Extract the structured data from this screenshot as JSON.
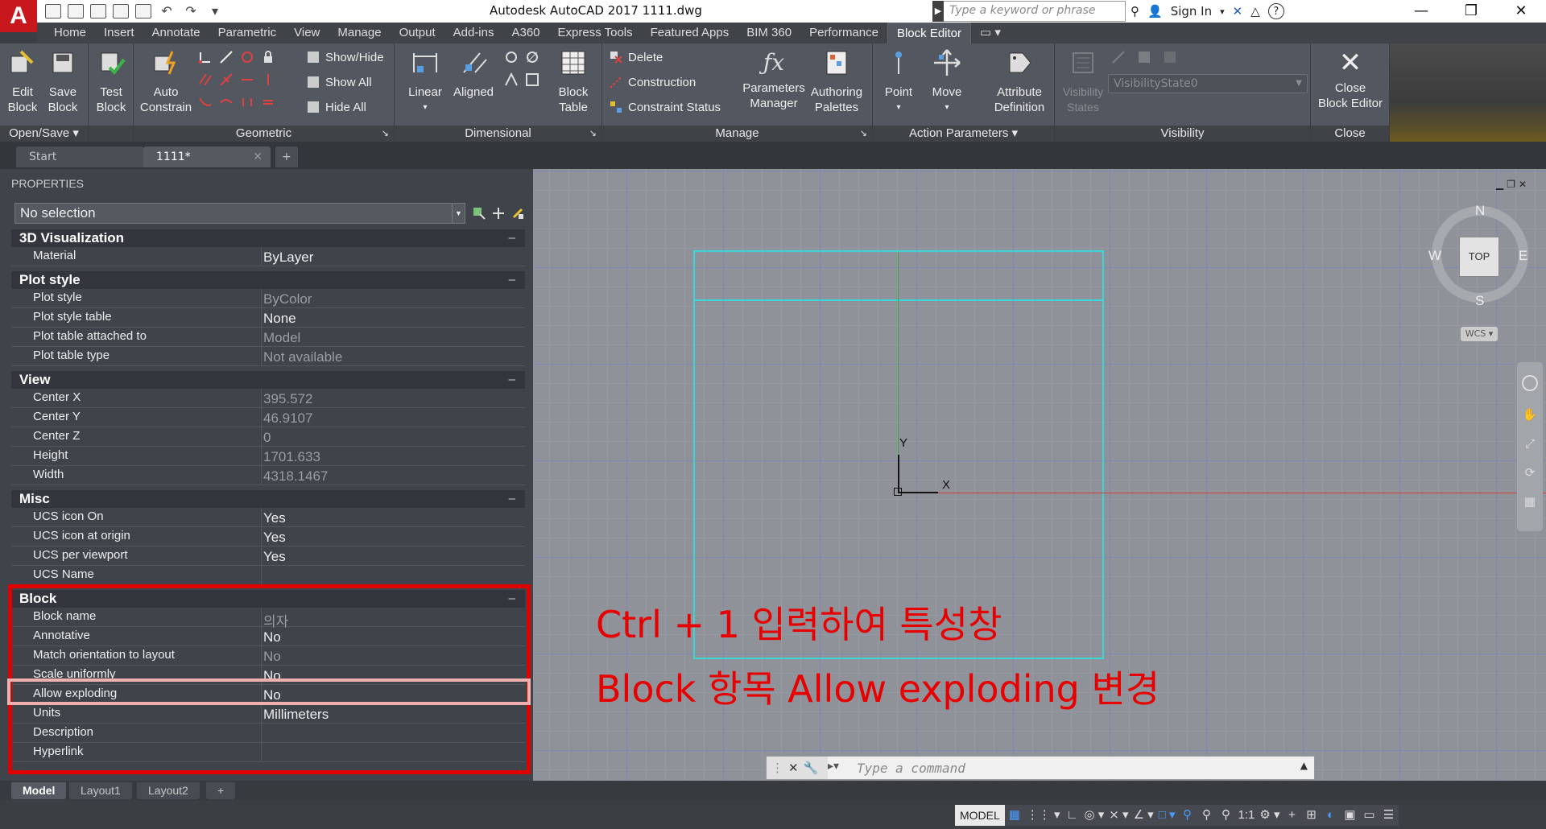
{
  "titlebar": {
    "logo": "A",
    "title": "Autodesk AutoCAD 2017     1111.dwg",
    "search_placeholder": "Type a keyword or phrase",
    "sign_in": "Sign In",
    "minimize": "—",
    "restore": "❐",
    "close": "✕"
  },
  "ribbon_tabs": [
    "Home",
    "Insert",
    "Annotate",
    "Parametric",
    "View",
    "Manage",
    "Output",
    "Add-ins",
    "A360",
    "Express Tools",
    "Featured Apps",
    "BIM 360",
    "Performance",
    "Block Editor"
  ],
  "ribbon": {
    "open_save": {
      "title": "Open/Save",
      "edit_block": "Edit\nBlock",
      "save_block": "Save\nBlock"
    },
    "test": {
      "label": "Test\nBlock"
    },
    "geometric": {
      "title": "Geometric",
      "auto_constrain": "Auto\nConstrain",
      "show_hide": "Show/Hide",
      "show_all": "Show All",
      "hide_all": "Hide All"
    },
    "dimensional": {
      "title": "Dimensional",
      "linear": "Linear",
      "aligned": "Aligned",
      "block_table": "Block\nTable"
    },
    "manage": {
      "title": "Manage",
      "delete": "Delete",
      "construction": "Construction",
      "constraint_status": "Constraint Status",
      "parameters_manager": "Parameters\nManager",
      "authoring_palettes": "Authoring\nPalettes"
    },
    "action_parameters": {
      "title": "Action Parameters",
      "point": "Point",
      "move": "Move",
      "attribute_definition": "Attribute\nDefinition"
    },
    "visibility": {
      "title": "Visibility",
      "visibility_states": "Visibility\nStates",
      "visibility_state_value": "VisibilityState0"
    },
    "close": {
      "title": "Close",
      "close_block_editor": "Close\nBlock Editor"
    }
  },
  "doc_tabs": {
    "start": "Start",
    "current": "1111*",
    "new_tab": "+"
  },
  "properties": {
    "title": "PROPERTIES",
    "selection": "No selection",
    "sections": [
      {
        "name": "3D Visualization",
        "rows": [
          {
            "name": "Material",
            "value": "ByLayer",
            "readonly": false
          }
        ]
      },
      {
        "name": "Plot style",
        "rows": [
          {
            "name": "Plot style",
            "value": "ByColor",
            "readonly": true
          },
          {
            "name": "Plot style table",
            "value": "None",
            "readonly": false
          },
          {
            "name": "Plot table attached to",
            "value": "Model",
            "readonly": true
          },
          {
            "name": "Plot table type",
            "value": "Not available",
            "readonly": true
          }
        ]
      },
      {
        "name": "View",
        "rows": [
          {
            "name": "Center X",
            "value": "395.572",
            "readonly": true
          },
          {
            "name": "Center Y",
            "value": "46.9107",
            "readonly": true
          },
          {
            "name": "Center Z",
            "value": "0",
            "readonly": true
          },
          {
            "name": "Height",
            "value": "1701.633",
            "readonly": true
          },
          {
            "name": "Width",
            "value": "4318.1467",
            "readonly": true
          }
        ]
      },
      {
        "name": "Misc",
        "rows": [
          {
            "name": "UCS icon On",
            "value": "Yes",
            "readonly": false
          },
          {
            "name": "UCS icon at origin",
            "value": "Yes",
            "readonly": false
          },
          {
            "name": "UCS per viewport",
            "value": "Yes",
            "readonly": false
          },
          {
            "name": "UCS Name",
            "value": "",
            "readonly": false
          }
        ]
      },
      {
        "name": "Block",
        "rows": [
          {
            "name": "Block name",
            "value": "의자",
            "readonly": true
          },
          {
            "name": "Annotative",
            "value": "No",
            "readonly": false
          },
          {
            "name": "Match orientation to layout",
            "value": "No",
            "readonly": true
          },
          {
            "name": "Scale uniformly",
            "value": "No",
            "readonly": false
          },
          {
            "name": "Allow exploding",
            "value": "No",
            "readonly": false
          },
          {
            "name": "Units",
            "value": "Millimeters",
            "readonly": false
          },
          {
            "name": "Description",
            "value": "",
            "readonly": false
          },
          {
            "name": "Hyperlink",
            "value": "",
            "readonly": false
          }
        ]
      }
    ]
  },
  "canvas": {
    "annotation_line1": "Ctrl + 1 입력하여 특성창",
    "annotation_line2": "Block 항목 Allow exploding 변경",
    "ucs_x": "X",
    "ucs_y": "Y",
    "viewcube": {
      "top": "TOP",
      "n": "N",
      "s": "S",
      "e": "E",
      "w": "W",
      "wcs": "WCS"
    }
  },
  "command_line": {
    "placeholder": "Type a command"
  },
  "layout_tabs": [
    "Model",
    "Layout1",
    "Layout2",
    "+"
  ],
  "statusbar": {
    "model": "MODEL",
    "scale": "1:1"
  },
  "colors": {
    "highlight_red": "#e00000",
    "annotation_red": "#e80000",
    "rect_cyan": "#38d8d8"
  }
}
